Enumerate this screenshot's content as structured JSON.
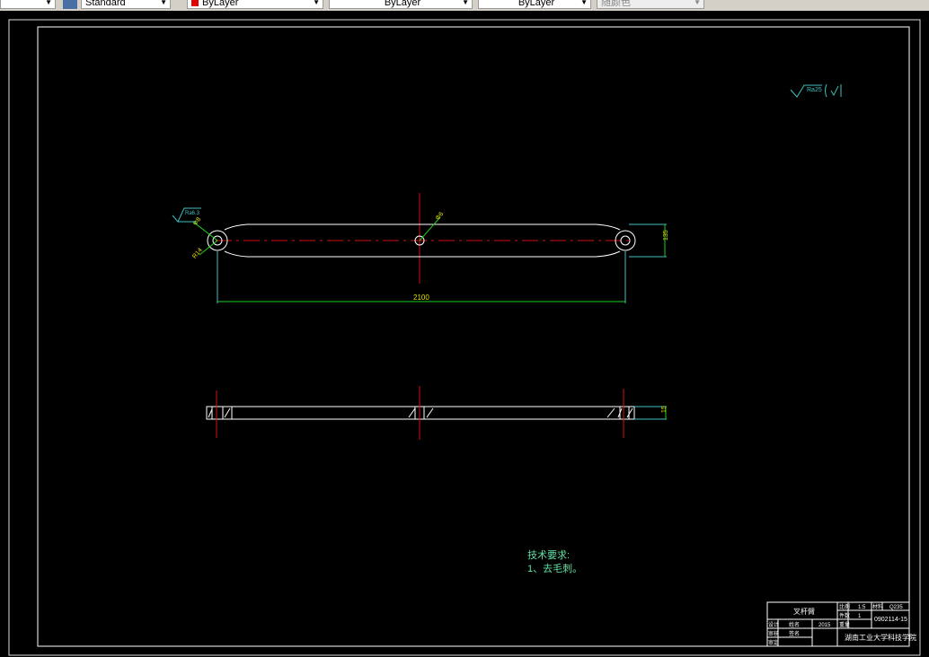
{
  "toolbar": {
    "text_style": "Standard",
    "layer_color": "ByLayer",
    "linetype": "ByLayer",
    "lineweight": "ByLayer",
    "plot_style": "随颜色",
    "layer_color_swatch": "#e00000"
  },
  "drawing": {
    "roughness_general": "Ra25",
    "roughness_local": "Ra6.3",
    "dim_hole_left_top": "Φ8",
    "dim_hole_left_bottom": "R14",
    "dim_hole_center": "Φ6",
    "dim_height": "135",
    "dim_length": "2100",
    "dim_thickness": "15",
    "tech_req_title": "技术要求:",
    "tech_req_item": "1、去毛刺。"
  },
  "title_block": {
    "part_name": "叉杆臂",
    "label_scale": "比例",
    "scale": "1:5",
    "label_material": "材料",
    "label_qty": "件数",
    "qty": "1",
    "material": "Q235",
    "drawing_no": "0902114-15",
    "label_weight": "重量",
    "label_design": "设计",
    "designer": "姓名",
    "date": "2015",
    "label_check": "审核",
    "checker": "签名",
    "label_approve": "审定",
    "school": "湖南工业大学科技学院"
  },
  "colors": {
    "white": "#ffffff",
    "red": "#d01010",
    "green": "#20d020",
    "cyan": "#40c0c0",
    "yellow": "#e0e000",
    "text_green": "#60e0a0"
  }
}
